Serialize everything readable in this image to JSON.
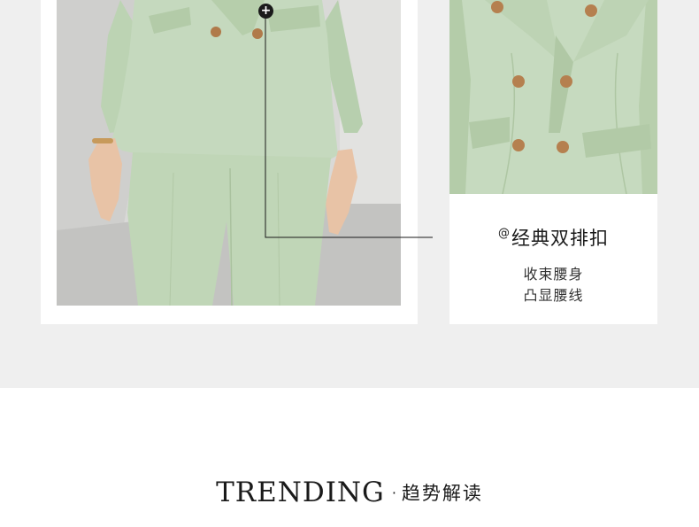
{
  "detail_card": {
    "title_prefix": "@",
    "title": "经典双排扣",
    "line1": "收束腰身",
    "line2": "凸显腰线"
  },
  "callout": {
    "marker_icon": "plus-icon",
    "marker_glyph": "+"
  },
  "trending": {
    "title_en": "TRENDING",
    "separator": "·",
    "title_cn": "趋势解读"
  },
  "colors": {
    "background_band": "#efefef",
    "card": "#ffffff",
    "suit_green": "#c4d8bd",
    "text": "#1a1a1a"
  }
}
